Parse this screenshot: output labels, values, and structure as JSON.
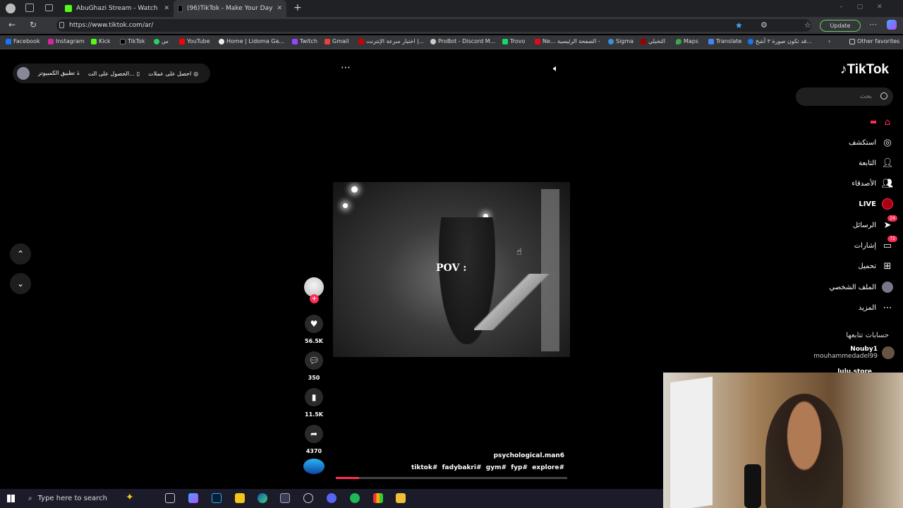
{
  "browser": {
    "tabs": [
      {
        "title": "AbuGhazi Stream - Watch Live on"
      },
      {
        "title": "(96)TikTok - Make Your Day"
      }
    ],
    "url": "https://www.tiktok.com/ar/",
    "update_label": "Update",
    "other_favorites": "Other favorites",
    "bookmarks": [
      "Facebook",
      "Instagram",
      "Kick",
      "TikTok",
      "س",
      "YouTube",
      "Home | Lidoma Ga...",
      "Twitch",
      "Gmail",
      "اختبار سرعة الإنترنت |...",
      "ProBot - Discord M...",
      "Trovo",
      "Ne...",
      "الصفحة الرئيسية -",
      "Sigma",
      "التخيلي",
      "Maps",
      "Translate",
      "قد تكون صورة ٣ أشخ..."
    ]
  },
  "topbar": {
    "get_coins": "احصل على عملات",
    "get_app": "الحصول على الت...",
    "desktop_app": "تطبيق الكمبيوتر"
  },
  "brand": {
    "logo_text": "TikTok"
  },
  "search": {
    "placeholder": "بحث"
  },
  "sidebar": {
    "items": [
      {
        "label": "استكشف"
      },
      {
        "label": "التابعة"
      },
      {
        "label": "الأصدقاء"
      },
      {
        "label": "LIVE"
      },
      {
        "label": "الرسائل",
        "badge": "24"
      },
      {
        "label": "إشارات",
        "badge": "72"
      },
      {
        "label": "تحميل"
      },
      {
        "label": "الملف الشخصي"
      },
      {
        "label": "المزيد"
      }
    ],
    "following_title": "حسابات تتابعها",
    "following": [
      {
        "name": "Nouby1",
        "handle": "mouhammedadel99"
      },
      {
        "name": "lulu.store"
      }
    ]
  },
  "video": {
    "overlay_text": "POV :",
    "author": "psychological.man6",
    "hashtags": "tiktok#  fadybakri#  gym#  fyp#  explore#",
    "progress": 0.1
  },
  "actions": {
    "likes": "56.5K",
    "comments": "350",
    "saves": "11.5K",
    "shares": "4370"
  },
  "taskbar": {
    "search_placeholder": "Type here to search"
  }
}
